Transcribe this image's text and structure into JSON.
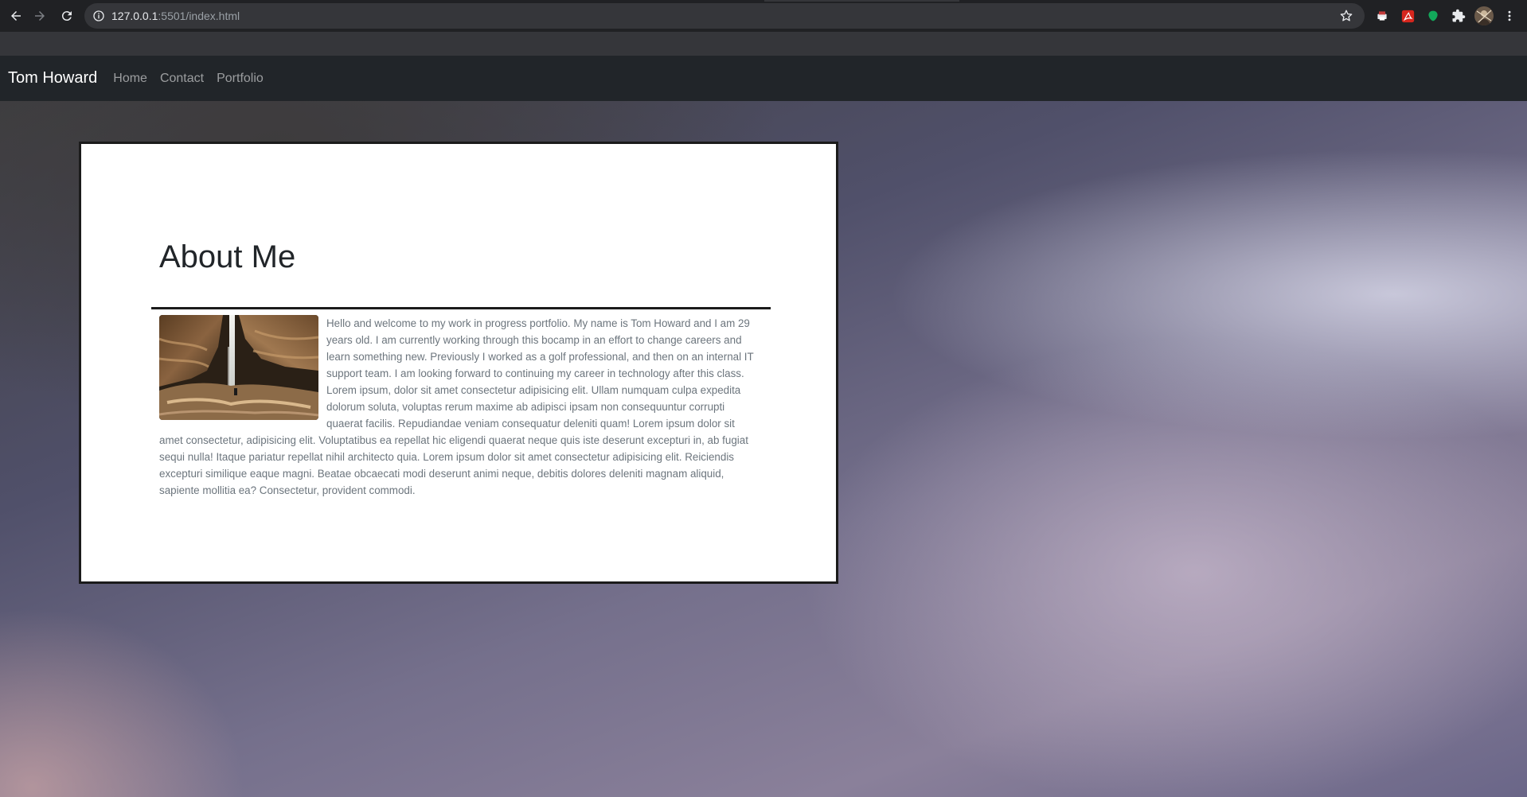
{
  "browser": {
    "url_host": "127.0.0.1",
    "url_rest": ":5501/index.html"
  },
  "navbar": {
    "brand": "Tom Howard",
    "links": [
      {
        "label": "Home"
      },
      {
        "label": "Contact"
      },
      {
        "label": "Portfolio"
      }
    ]
  },
  "about": {
    "title": "About Me",
    "image_icon": "waterfall-photo",
    "text": "Hello and welcome to my work in progress portfolio. My name is Tom Howard and I am 29 years old. I am currently working through this bocamp in an effort to change careers and learn something new. Previously I worked as a golf professional, and then on an internal IT support team. I am looking forward to continuing my career in technology after this class. Lorem ipsum, dolor sit amet consectetur adipisicing elit. Ullam numquam culpa expedita dolorum soluta, voluptas rerum maxime ab adipisci ipsam non consequuntur corrupti quaerat facilis. Repudiandae veniam consequatur deleniti quam! Lorem ipsum dolor sit amet consectetur, adipisicing elit. Voluptatibus ea repellat hic eligendi quaerat neque quis iste deserunt excepturi in, ab fugiat sequi nulla! Itaque pariatur repellat nihil architecto quia. Lorem ipsum dolor sit amet consectetur adipisicing elit. Reiciendis excepturi similique eaque magni. Beatae obcaecati modi deserunt animi neque, debitis dolores deleniti magnam aliquid, sapiente mollitia ea? Consectetur, provident commodi."
  },
  "colors": {
    "navbar_bg": "#212529",
    "chrome_bg": "#202124",
    "omnibox_bg": "#35363a"
  }
}
